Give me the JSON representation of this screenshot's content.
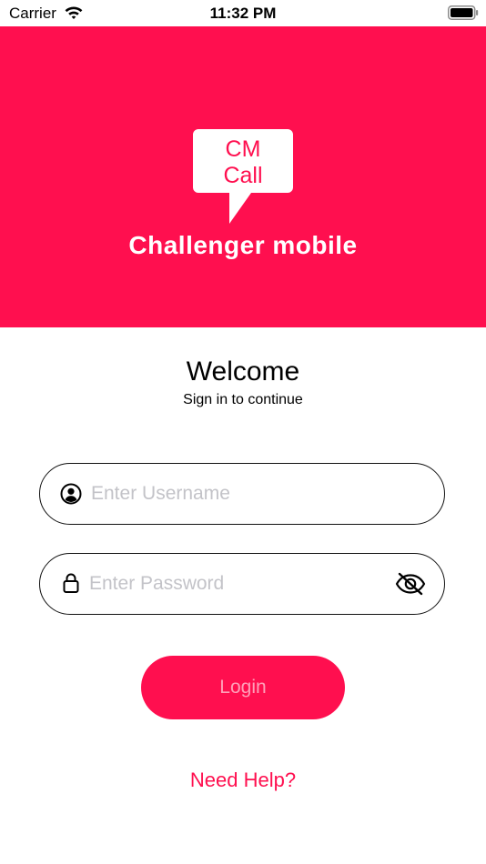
{
  "status_bar": {
    "carrier": "Carrier",
    "time": "11:32 PM"
  },
  "header": {
    "logo_line1": "CM",
    "logo_line2": "Call",
    "brand": "Challenger mobile",
    "background_color": "#ff0f4f"
  },
  "main": {
    "title": "Welcome",
    "subtitle": "Sign in to continue"
  },
  "form": {
    "username_placeholder": "Enter Username",
    "username_value": "",
    "password_placeholder": "Enter Password",
    "password_value": "",
    "login_label": "Login",
    "help_label": "Need Help?"
  },
  "colors": {
    "accent": "#ff0f4f"
  }
}
